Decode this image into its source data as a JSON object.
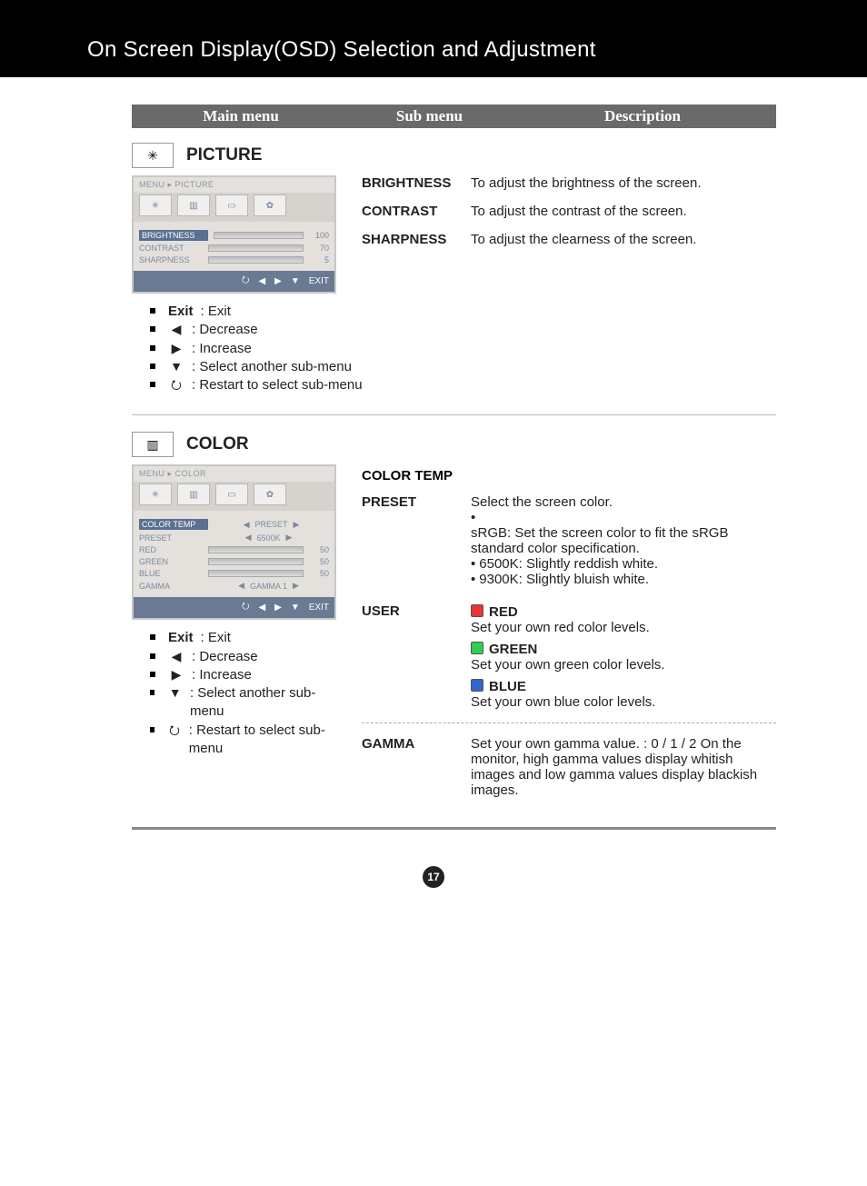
{
  "header": "On Screen Display(OSD) Selection and Adjustment",
  "columns": {
    "c1": "Main menu",
    "c2": "Sub menu",
    "c3": "Description"
  },
  "picture": {
    "title": "PICTURE",
    "osd": {
      "breadcrumb": "MENU ▸ PICTURE",
      "rows": [
        {
          "label": "BRIGHTNESS",
          "value": "100",
          "active": true
        },
        {
          "label": "CONTRAST",
          "value": "70"
        },
        {
          "label": "SHARPNESS",
          "value": "5"
        }
      ],
      "footer_exit": "EXIT"
    },
    "items": [
      {
        "sub": "BRIGHTNESS",
        "desc": "To adjust the brightness of the screen."
      },
      {
        "sub": "CONTRAST",
        "desc": "To adjust the contrast of the screen."
      },
      {
        "sub": "SHARPNESS",
        "desc": "To adjust the clearness of the screen."
      }
    ],
    "legend": {
      "exit": {
        "label": "Exit",
        "desc": ": Exit"
      },
      "left": ": Decrease",
      "right": ": Increase",
      "down": ": Select another sub-menu",
      "return": ": Restart to select sub-menu"
    }
  },
  "color": {
    "title": "COLOR",
    "osd": {
      "breadcrumb": "MENU ▸ COLOR",
      "rows": [
        {
          "type": "head",
          "label": "COLOR TEMP",
          "value": "PRESET"
        },
        {
          "type": "text",
          "label": "PRESET",
          "value": "6500K"
        },
        {
          "type": "slider",
          "label": "RED",
          "value": "50"
        },
        {
          "type": "slider",
          "label": "GREEN",
          "value": "50"
        },
        {
          "type": "slider",
          "label": "BLUE",
          "value": "50"
        },
        {
          "type": "text",
          "label": "GAMMA",
          "value": "GAMMA 1"
        }
      ],
      "footer_exit": "EXIT"
    },
    "heading": "COLOR TEMP",
    "preset": {
      "sub": "PRESET",
      "intro": "Select the screen color.",
      "opts": [
        "sRGB: Set the screen color to fit the sRGB standard color specification.",
        "6500K: Slightly reddish white.",
        "9300K: Slightly bluish white."
      ]
    },
    "user": {
      "sub": "USER",
      "red": {
        "label": "RED",
        "desc": "Set your own red color levels."
      },
      "green": {
        "label": "GREEN",
        "desc": "Set your own green color levels."
      },
      "blue": {
        "label": "BLUE",
        "desc": "Set your own blue color levels."
      }
    },
    "gamma": {
      "sub": "GAMMA",
      "desc": "Set your own gamma value. : 0 / 1 / 2 On the monitor, high gamma values display whitish images and low gamma values display blackish images."
    },
    "legend": {
      "exit": {
        "label": "Exit",
        "desc": ": Exit"
      },
      "left": ": Decrease",
      "right": ": Increase",
      "down": ": Select another sub-menu",
      "return": ": Restart to select sub-menu"
    }
  },
  "page_number": "17"
}
